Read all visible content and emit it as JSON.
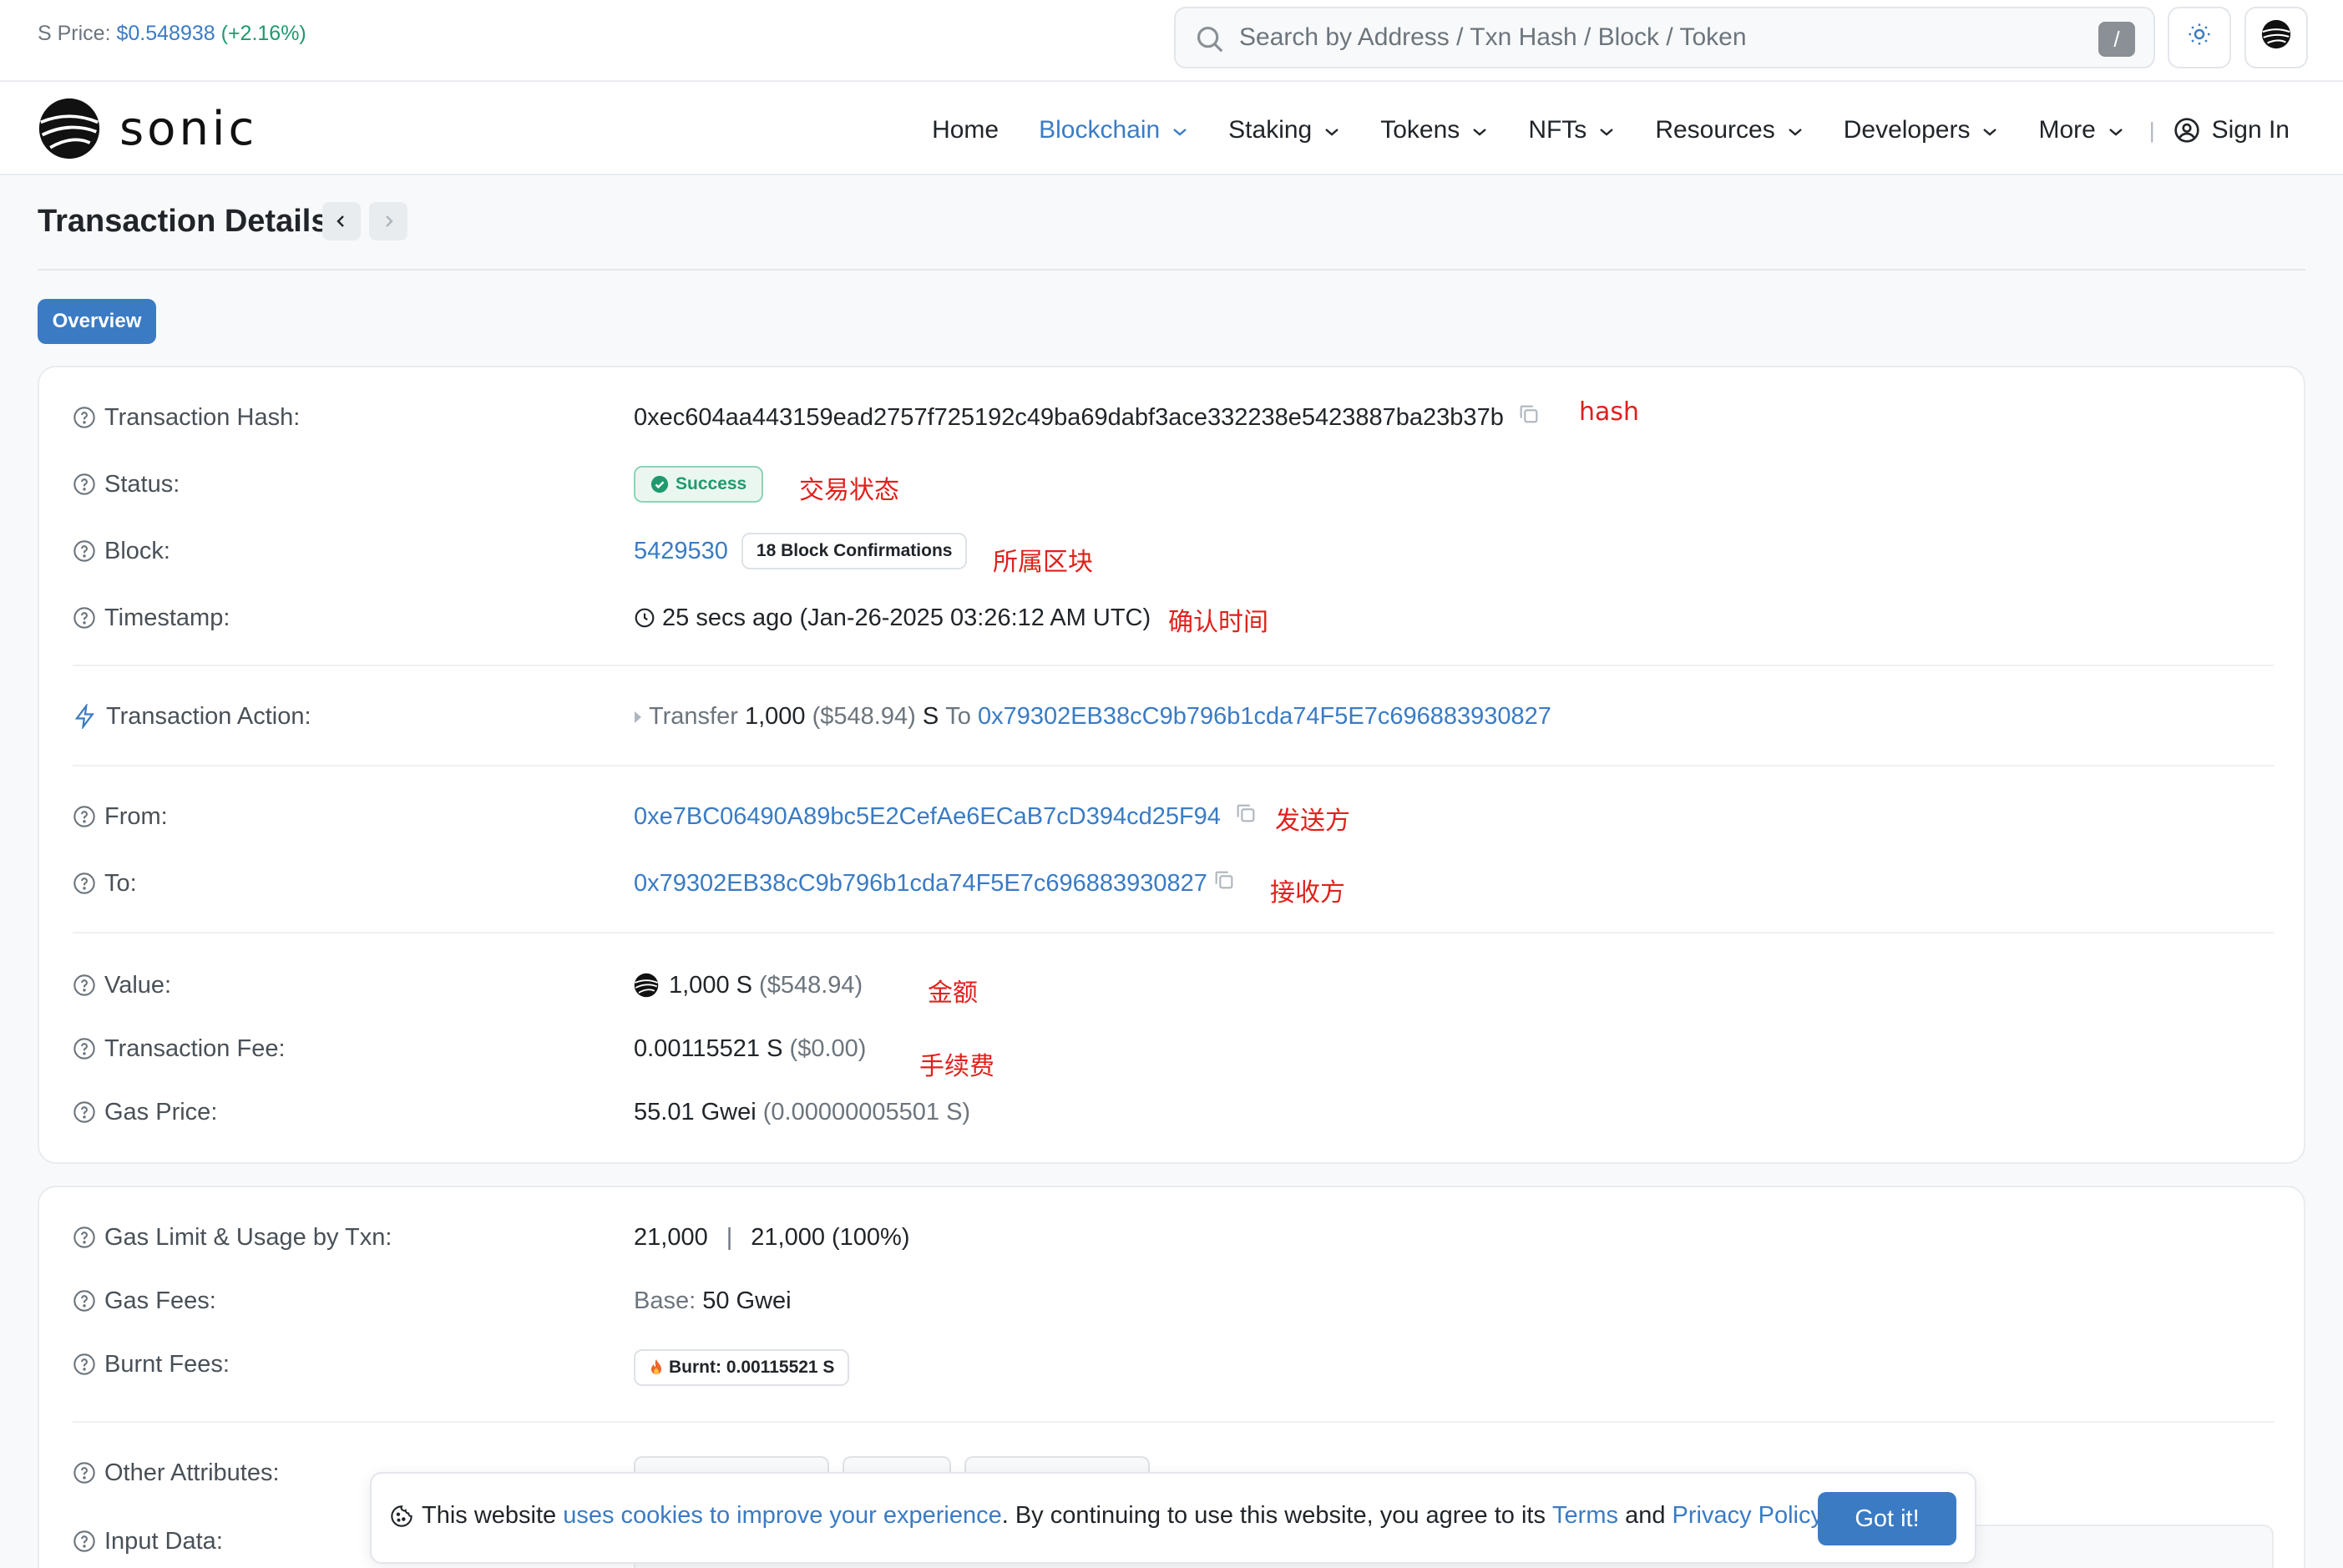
{
  "topbar": {
    "price_label": "S Price:",
    "price_value": "$0.548938",
    "price_change": "(+2.16%)",
    "search_placeholder": "Search by Address / Txn Hash / Block / Token",
    "search_shortcut": "/"
  },
  "brand": {
    "name": "SONIC"
  },
  "nav": {
    "items": [
      "Home",
      "Blockchain",
      "Staking",
      "Tokens",
      "NFTs",
      "Resources",
      "Developers",
      "More"
    ],
    "separator": "|",
    "sign_in": "Sign In"
  },
  "page": {
    "title": "Transaction Details",
    "tab": "Overview"
  },
  "labels": {
    "hash": "Transaction Hash:",
    "status": "Status:",
    "block": "Block:",
    "timestamp": "Timestamp:",
    "action": "Transaction Action:",
    "from": "From:",
    "to": "To:",
    "value": "Value:",
    "fee": "Transaction Fee:",
    "gas_price": "Gas Price:",
    "gas_limit": "Gas Limit & Usage by Txn:",
    "gas_fees": "Gas Fees:",
    "burnt_fees": "Burnt Fees:",
    "other_attributes": "Other Attributes:",
    "input_data": "Input Data:"
  },
  "tx": {
    "hash": "0xec604aa443159ead2757f725192c49ba69dabf3ace332238e5423887ba23b37b",
    "status": "Success",
    "block": "5429530",
    "confirmations": "18 Block Confirmations",
    "timestamp": "25 secs ago (Jan-26-2025 03:26:12 AM UTC)",
    "action": {
      "verb": "Transfer",
      "amount": "1,000",
      "usd": "($548.94)",
      "token": "S",
      "to_word": "To",
      "to_address": "0x79302EB38cC9b796b1cda74F5E7c696883930827"
    },
    "from": "0xe7BC06490A89bc5E2CefAe6ECaB7cD394cd25F94",
    "to": "0x79302EB38cC9b796b1cda74F5E7c696883930827",
    "value": "1,000 S",
    "value_usd": "($548.94)",
    "fee": "0.00115521 S",
    "fee_usd": "($0.00)",
    "gas_price": "55.01 Gwei",
    "gas_price_detail": "(0.00000005501 S)",
    "gas_limit": "21,000",
    "gas_limit_sep": "|",
    "gas_usage": "21,000 (100%)",
    "gas_fees_base_label": "Base:",
    "gas_fees_base": "50 Gwei",
    "burnt": "Burnt: 0.00115521 S"
  },
  "annotations": {
    "hash": "hash",
    "status": "交易状态",
    "block": "所属区块",
    "timestamp": "确认时间",
    "from": "发送方",
    "to": "接收方",
    "value": "金额",
    "fee": "手续费"
  },
  "cookie": {
    "text_1": "This website",
    "link_1": "uses cookies to improve your experience",
    "text_2": ". By continuing to use this website, you agree to its",
    "link_terms": "Terms",
    "text_and": "and",
    "link_privacy": "Privacy Policy",
    "text_end": ".",
    "button": "Got it!"
  },
  "colors": {
    "accent": "#3a7bc4",
    "success": "#1f9a6d",
    "annotation": "#e0201c"
  }
}
